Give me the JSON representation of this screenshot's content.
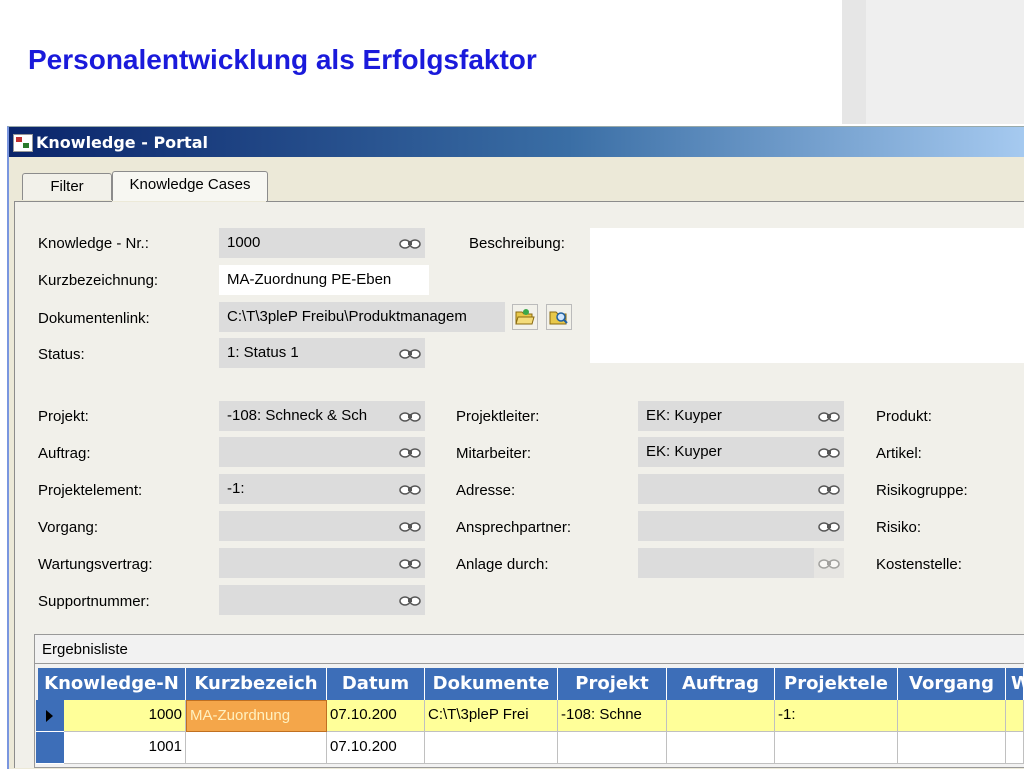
{
  "slide": {
    "title": "Personalentwicklung als Erfolgsfaktor"
  },
  "window": {
    "title": "Knowledge - Portal"
  },
  "tabs": [
    {
      "label": "Filter"
    },
    {
      "label": "Knowledge Cases",
      "active": true
    }
  ],
  "form": {
    "knowledge_nr": {
      "label": "Knowledge - Nr.:",
      "value": "1000"
    },
    "kurzbezeichnung": {
      "label": "Kurzbezeichnung:",
      "value": "MA-Zuordnung PE-Eben"
    },
    "dokumentenlink": {
      "label": "Dokumentenlink:",
      "value": "C:\\T\\3pleP Freibu\\Produktmanagem"
    },
    "status": {
      "label": "Status:",
      "value": "1: Status 1"
    },
    "beschreibung": {
      "label": "Beschreibung:",
      "value": ""
    },
    "projekt": {
      "label": "Projekt:",
      "value": "-108: Schneck & Sch"
    },
    "auftrag": {
      "label": "Auftrag:",
      "value": ""
    },
    "projektelement": {
      "label": "Projektelement:",
      "value": "-1:"
    },
    "vorgang": {
      "label": "Vorgang:",
      "value": ""
    },
    "wartungsvertrag": {
      "label": "Wartungsvertrag:",
      "value": ""
    },
    "supportnummer": {
      "label": "Supportnummer:",
      "value": ""
    },
    "projektleiter": {
      "label": "Projektleiter:",
      "value": "EK: Kuyper"
    },
    "mitarbeiter": {
      "label": "Mitarbeiter:",
      "value": "EK: Kuyper"
    },
    "adresse": {
      "label": "Adresse:",
      "value": ""
    },
    "ansprechpartner": {
      "label": "Ansprechpartner:",
      "value": ""
    },
    "anlage_durch": {
      "label": "Anlage durch:",
      "value": ""
    },
    "produkt": {
      "label": "Produkt:"
    },
    "artikel": {
      "label": "Artikel:"
    },
    "risikogruppe": {
      "label": "Risikogruppe:"
    },
    "risiko": {
      "label": "Risiko:"
    },
    "kostenstelle": {
      "label": "Kostenstelle:"
    }
  },
  "results": {
    "caption": "Ergebnisliste",
    "columns": [
      "Knowledge-N",
      "Kurzbezeich",
      "Datum",
      "Dokumente",
      "Projekt",
      "Auftrag",
      "Projektele",
      "Vorgang",
      "W"
    ],
    "rows": [
      [
        "1000",
        "MA-Zuordnung",
        "07.10.200",
        "C:\\T\\3pleP Frei",
        "-108: Schne",
        "",
        "-1:",
        "",
        ""
      ],
      [
        "1001",
        "",
        "07.10.200",
        "",
        "",
        "",
        "",
        "",
        ""
      ]
    ]
  },
  "icons": {
    "lookup": "binoculars-icon",
    "open_doc": "folder-open-icon",
    "browse_doc": "folder-search-icon"
  }
}
